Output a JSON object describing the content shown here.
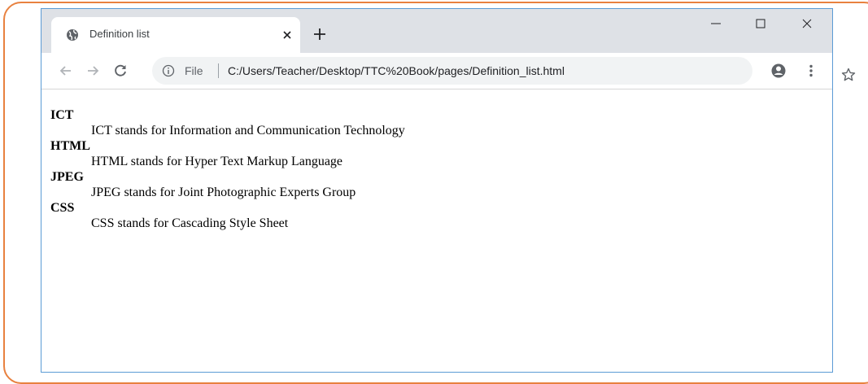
{
  "tab": {
    "title": "Definition list"
  },
  "address_bar": {
    "scheme_label": "File",
    "url": "C:/Users/Teacher/Desktop/TTC%20Book/pages/Definition_list.html"
  },
  "icons": {
    "tab_favicon": "globe-icon",
    "close_tab": "close-icon",
    "new_tab": "plus-icon",
    "back": "arrow-left-icon",
    "forward": "arrow-right-icon",
    "reload": "reload-icon",
    "site_info": "info-icon",
    "bookmark": "star-icon",
    "profile": "account-icon",
    "menu": "kebab-menu-icon"
  },
  "definitions": [
    {
      "term": "ICT",
      "description": "ICT stands for Information and Communication Technology"
    },
    {
      "term": "HTML",
      "description": "HTML stands for Hyper Text Markup Language"
    },
    {
      "term": "JPEG",
      "description": "JPEG stands for Joint Photographic Experts Group"
    },
    {
      "term": "CSS",
      "description": "CSS stands for Cascading Style Sheet"
    }
  ],
  "colors": {
    "frame_border": "#e8813f",
    "window_border": "#5b9bd5",
    "tabstrip": "#dee1e6",
    "omnibox": "#f1f3f4"
  }
}
